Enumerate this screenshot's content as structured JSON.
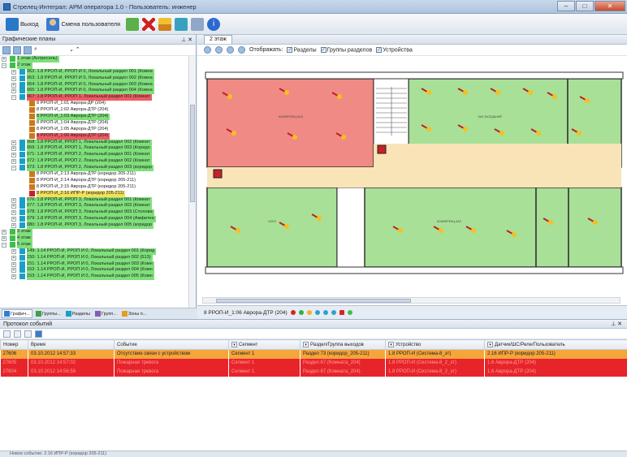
{
  "window": {
    "title": "Стрелец-Интеграл: АРМ оператора 1.0 - Пользователь: инженер",
    "buttons": [
      "–",
      "□",
      "✕"
    ]
  },
  "toolbar": {
    "exit_label": "Выход",
    "change_user_label": "Смена пользователя"
  },
  "left_panel": {
    "title": "Графические планы",
    "close": "⊥ ✕",
    "tree": [
      {
        "depth": 0,
        "exp": "+",
        "color": "#3fbf4a",
        "text": "1 этаж (Антресоль)",
        "hl": "#7ee07a"
      },
      {
        "depth": 0,
        "exp": "–",
        "color": "#3fbf4a",
        "text": "2 этаж",
        "hl": "#7ee07a"
      },
      {
        "depth": 1,
        "exp": "+",
        "color": "#1aa0c8",
        "text": "062: 1.8 РРОП-И, РРОП И 0, Локальный раздел 001 (Комна",
        "hl": "#7ee07a"
      },
      {
        "depth": 1,
        "exp": "+",
        "color": "#1aa0c8",
        "text": "063: 1.8 РРОП-И, РРОП И 0, Локальный раздел 002 (Комна",
        "hl": "#7ee07a"
      },
      {
        "depth": 1,
        "exp": "+",
        "color": "#1aa0c8",
        "text": "064: 1.8 РРОП-И, РРОП И 0, Локальный раздел 003 (Комна",
        "hl": "#7ee07a"
      },
      {
        "depth": 1,
        "exp": "+",
        "color": "#1aa0c8",
        "text": "065: 1.8 РРОП-И, РРОП И 0, Локальный раздел 004 (Комна",
        "hl": "#7ee07a"
      },
      {
        "depth": 1,
        "exp": "–",
        "color": "#1aa0c8",
        "text": "067: 1.8 РРОП-И, РРОП 1, Локальный раздел 001 (Комнат",
        "hl": "#ef5b63"
      },
      {
        "depth": 2,
        "exp": "",
        "color": "#c87a1a",
        "text": "8 РРОП-И_1:01 Аврора-ДР (204)",
        "hl": ""
      },
      {
        "depth": 2,
        "exp": "",
        "color": "#c87a1a",
        "text": "8 РРОП-И_1:02 Аврора-ДТР (204)",
        "hl": ""
      },
      {
        "depth": 2,
        "exp": "",
        "color": "#c87a1a",
        "text": "8 РРОП-И_1:03 Аврора-ДТР (204)",
        "hl": "#7ee07a"
      },
      {
        "depth": 2,
        "exp": "",
        "color": "#c87a1a",
        "text": "8 РРОП-И_1:04 Аврора-ДТР (204)",
        "hl": ""
      },
      {
        "depth": 2,
        "exp": "",
        "color": "#c87a1a",
        "text": "8 РРОП-И_1:05 Аврора-ДТР (204)",
        "hl": ""
      },
      {
        "depth": 2,
        "exp": "",
        "color": "#c87a1a",
        "text": "8 РРОП-И_1:06 Аврора-ДТР (204)",
        "hl": "#ef5b63"
      },
      {
        "depth": 1,
        "exp": "+",
        "color": "#1aa0c8",
        "text": "068: 1.8 РРОП-И, РРОП 1, Локальный раздел 002 (Комнат",
        "hl": "#7ee07a"
      },
      {
        "depth": 1,
        "exp": "+",
        "color": "#1aa0c8",
        "text": "069: 1.8 РРОП-И, РРОП 1, Локальный раздел 003 (Коридо",
        "hl": "#7ee07a"
      },
      {
        "depth": 1,
        "exp": "+",
        "color": "#1aa0c8",
        "text": "071: 1.8 РРОП-И, РРОП 2, Локальный раздел 001 (Комнат",
        "hl": "#7ee07a"
      },
      {
        "depth": 1,
        "exp": "+",
        "color": "#1aa0c8",
        "text": "072: 1.8 РРОП-И, РРОП 2, Локальный раздел 002 (Комнат",
        "hl": "#7ee07a"
      },
      {
        "depth": 1,
        "exp": "–",
        "color": "#1aa0c8",
        "text": "073: 1.8 РРОП-И, РРОП 2, Локальный раздел 003 (коридор",
        "hl": "#7ee07a"
      },
      {
        "depth": 2,
        "exp": "",
        "color": "#c87a1a",
        "text": "8 РРОП-И_2:13 Аврора-ДТР (коридор 205-211)",
        "hl": ""
      },
      {
        "depth": 2,
        "exp": "",
        "color": "#c87a1a",
        "text": "8 РРОП-И_2:14 Аврора-ДТР (коридор 205-211)",
        "hl": ""
      },
      {
        "depth": 2,
        "exp": "",
        "color": "#c87a1a",
        "text": "8 РРОП-И_2:15 Аврора-ДТР (коридор 205-211)",
        "hl": ""
      },
      {
        "depth": 2,
        "exp": "",
        "color": "#c8202a",
        "text": "8 РРОП-И_2:16 ИПР-Р (коридор 205-211)",
        "hl": "#f4e15a"
      },
      {
        "depth": 1,
        "exp": "+",
        "color": "#1aa0c8",
        "text": "076: 1.8 РРОП-И, РРОП 3, Локальный раздел 001 (Комнат",
        "hl": "#7ee07a"
      },
      {
        "depth": 1,
        "exp": "+",
        "color": "#1aa0c8",
        "text": "077: 1.8 РРОП-И, РРОП 3, Локальный раздел 002 (Комнат",
        "hl": "#7ee07a"
      },
      {
        "depth": 1,
        "exp": "+",
        "color": "#1aa0c8",
        "text": "078: 1.8 РРОП-И, РРОП 3, Локальный раздел 003 (Столова",
        "hl": "#7ee07a"
      },
      {
        "depth": 1,
        "exp": "+",
        "color": "#1aa0c8",
        "text": "079: 1.8 РРОП-И, РРОП 3, Локальный раздел 004 (Амфитеа",
        "hl": "#7ee07a"
      },
      {
        "depth": 1,
        "exp": "+",
        "color": "#1aa0c8",
        "text": "080: 1.8 РРОП-И, РРОП 3, Локальный раздел 005 (коридор",
        "hl": "#7ee07a"
      },
      {
        "depth": 0,
        "exp": "+",
        "color": "#3fbf4a",
        "text": "3 этаж",
        "hl": "#7ee07a"
      },
      {
        "depth": 0,
        "exp": "+",
        "color": "#3fbf4a",
        "text": "4 этаж",
        "hl": "#7ee07a"
      },
      {
        "depth": 0,
        "exp": "–",
        "color": "#3fbf4a",
        "text": "5 этаж",
        "hl": "#7ee07a"
      },
      {
        "depth": 1,
        "exp": "+",
        "color": "#1aa0c8",
        "text": "149: 1.14 РРОП-И, РРОП И 0, Локальный раздел 001 (Корид",
        "hl": "#7ee07a"
      },
      {
        "depth": 1,
        "exp": "+",
        "color": "#1aa0c8",
        "text": "150: 1.14 РРОП-И, РРОП И 0, Локальный раздел 002 (513)",
        "hl": "#7ee07a"
      },
      {
        "depth": 1,
        "exp": "+",
        "color": "#1aa0c8",
        "text": "151: 1.14 РРОП-И, РРОП И 0, Локальный раздел 003 (Комн",
        "hl": "#7ee07a"
      },
      {
        "depth": 1,
        "exp": "+",
        "color": "#1aa0c8",
        "text": "152: 1.14 РРОП-И, РРОП И 0, Локальный раздел 004 (Комн",
        "hl": "#7ee07a"
      },
      {
        "depth": 1,
        "exp": "+",
        "color": "#1aa0c8",
        "text": "153: 1.14 РРОП-И, РРОП И 0, Локальный раздел 005 (Комн",
        "hl": "#7ee07a"
      }
    ],
    "tabs": [
      {
        "label": "Графич...",
        "color": "#2f7fd0"
      },
      {
        "label": "Группы...",
        "color": "#3fa04a"
      },
      {
        "label": "Разделы",
        "color": "#1aa0c8"
      },
      {
        "label": "Групп...",
        "color": "#8a5ab0"
      },
      {
        "label": "Зоны п...",
        "color": "#e0a020"
      }
    ]
  },
  "map": {
    "tab_label": "2 этаж",
    "show_label": "Отображать:",
    "filters": [
      "Разделы",
      "Группы разделов",
      "Устройства"
    ],
    "room_labels": [
      "КОНФЕРЕНЦ-ЗАЛ",
      "ЗАЛ ЗАСЕДАНИЙ",
      "ХОЛЛ",
      "КОНФЕРЕНЦ-ЗАЛ"
    ],
    "status_device": "8 РРОП-И_1:06 Аврора-ДТР (204)"
  },
  "events": {
    "title": "Протокол событий",
    "close": "⊥ ✕",
    "columns": [
      "Номер",
      "Время",
      "Событие",
      "Сегмент",
      "Раздел/Группа выходов",
      "Устройство",
      "Датчик/ШС/Реле/Пользователь"
    ],
    "rows": [
      {
        "kind": "orange",
        "cells": [
          "27606",
          "03.10.2012 14:57:33",
          "Отсутствие связи с устройством",
          "Сегмент 1",
          "Раздел 73 (коридор_205-211)",
          "1.8 РРОП-И (Система-8_эт)",
          "2.16 ИПР-Р (коридор 205-211)"
        ]
      },
      {
        "kind": "red",
        "cells": [
          "27605",
          "03.10.2012 14:57:02",
          "Пожарная тревога",
          "Сегмент 1",
          "Раздел 67 (Комната_204)",
          "1.8 РРОП-И (Система-8_2_эт)",
          "1.6 Аврора-ДТР (204)"
        ]
      },
      {
        "kind": "red",
        "cells": [
          "27604",
          "03.10.2012 14:56:58",
          "Пожарная тревога",
          "Сегмент 1",
          "Раздел 67 (Комната_204)",
          "1.8 РРОП-И (Система-8_2_эт)",
          "1.6 Аврора-ДТР (204)"
        ]
      }
    ]
  },
  "statusbar": {
    "text": "Новое событие: 2.16 ИПР-Р (коридор 205-211)"
  }
}
